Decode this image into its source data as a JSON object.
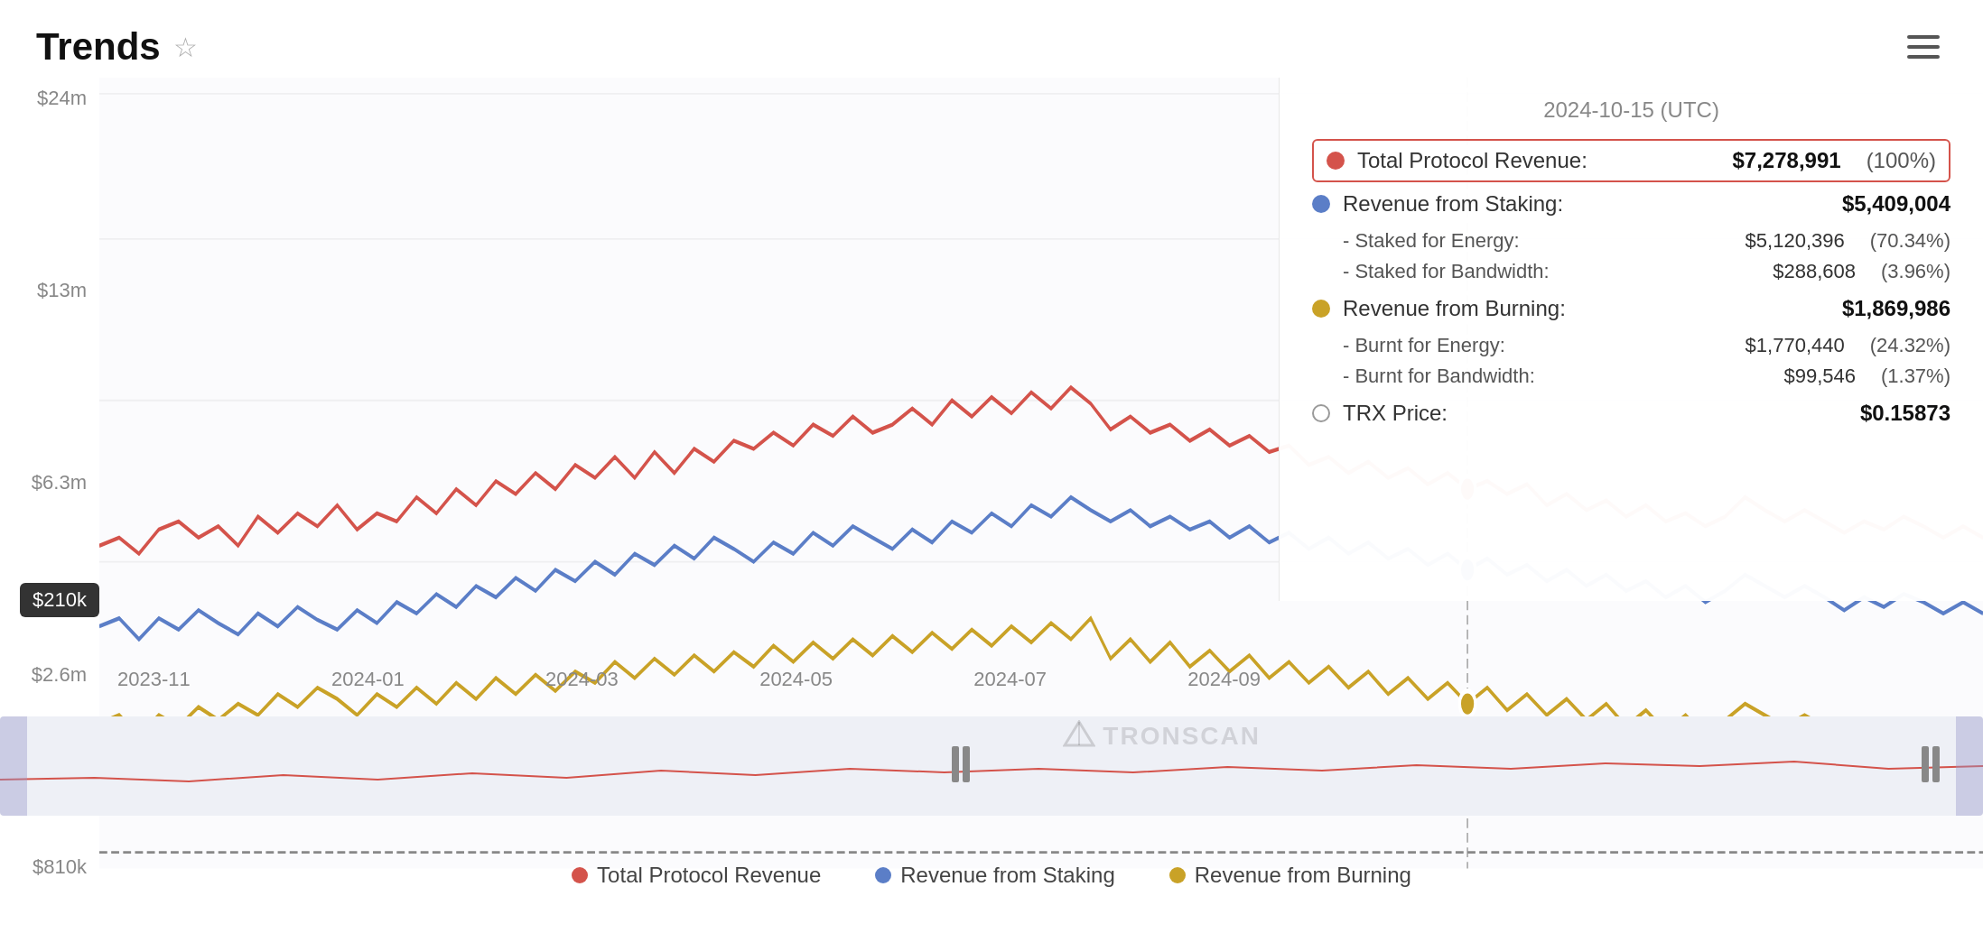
{
  "header": {
    "title": "Trends",
    "star_icon": "☆",
    "menu_label": "menu"
  },
  "tooltip": {
    "date": "2024-10-15 (UTC)",
    "total_protocol_revenue": {
      "label": "Total Protocol Revenue:",
      "value": "$7,278,991",
      "pct": "(100%)"
    },
    "revenue_from_staking": {
      "label": "Revenue from Staking:",
      "value": "$5,409,004"
    },
    "staked_for_energy": {
      "label": "- Staked for Energy:",
      "value": "$5,120,396",
      "pct": "(70.34%)"
    },
    "staked_for_bandwidth": {
      "label": "- Staked for Bandwidth:",
      "value": "$288,608",
      "pct": "(3.96%)"
    },
    "revenue_from_burning": {
      "label": "Revenue from Burning:",
      "value": "$1,869,986"
    },
    "burnt_for_energy": {
      "label": "- Burnt for Energy:",
      "value": "$1,770,440",
      "pct": "(24.32%)"
    },
    "burnt_for_bandwidth": {
      "label": "- Burnt for Bandwidth:",
      "value": "$99,546",
      "pct": "(1.37%)"
    },
    "trx_price": {
      "label": "TRX Price:",
      "value": "$0.15873"
    }
  },
  "chart": {
    "y_labels": [
      "$24m",
      "$13m",
      "$6.3m",
      "$2.6m",
      "$810k"
    ],
    "x_labels": [
      "2023-11",
      "2024-01",
      "2024-03",
      "2024-05",
      "2024-07",
      "2024-09"
    ],
    "value_badge": "$210k",
    "colors": {
      "red": "#d4534b",
      "blue": "#5b7ec7",
      "yellow": "#c9a227"
    }
  },
  "legend": {
    "items": [
      {
        "label": "Total Protocol Revenue",
        "color": "#d4534b"
      },
      {
        "label": "Revenue from Staking",
        "color": "#5b7ec7"
      },
      {
        "label": "Revenue from Burning",
        "color": "#c9a227"
      }
    ]
  },
  "watermark": "TRONSCAN"
}
